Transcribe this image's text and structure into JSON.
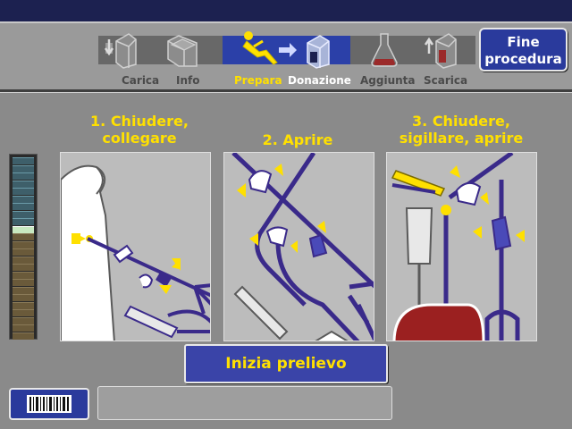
{
  "nav": {
    "steps": [
      {
        "id": "carica",
        "label": "Carica",
        "icon": "load-icon"
      },
      {
        "id": "info",
        "label": "Info",
        "icon": "folder-icon"
      },
      {
        "id": "prepara",
        "label": "Prepara",
        "icon": "patient-icon",
        "state": "current"
      },
      {
        "id": "donazione",
        "label": "Donazione",
        "icon": "donation-icon"
      },
      {
        "id": "aggiunta",
        "label": "Aggiunta",
        "icon": "flask-icon"
      },
      {
        "id": "scarica",
        "label": "Scarica",
        "icon": "unload-icon"
      }
    ],
    "end_button": {
      "line1": "Fine",
      "line2": "procedura"
    }
  },
  "instructions": {
    "steps": [
      {
        "title_line1": "1. Chiudere,",
        "title_line2": "collegare"
      },
      {
        "title_line1": "2. Aprire",
        "title_line2": ""
      },
      {
        "title_line1": "3. Chiudere,",
        "title_line2": "sigillare, aprire"
      }
    ]
  },
  "actions": {
    "start_label": "Inizia prelievo"
  },
  "message": {
    "text": ""
  },
  "colors": {
    "accent_yellow": "#ffe000",
    "button_blue": "#2a3a9c",
    "tubing_purple": "#3a2a8a",
    "header_dark": "#1c2150"
  },
  "meter": {
    "total_segments": 24,
    "level_segment": 9
  }
}
